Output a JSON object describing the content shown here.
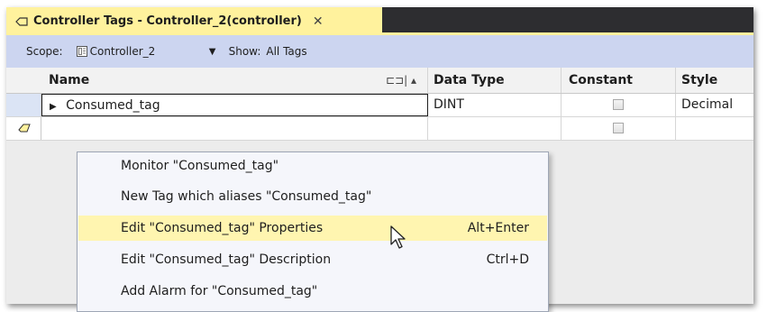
{
  "tab": {
    "title": "Controller Tags - Controller_2(controller)",
    "close_glyph": "✕",
    "icon": "tag-icon"
  },
  "scope_bar": {
    "scope_label": "Scope:",
    "scope_value": "Controller_2",
    "scope_icon": "controller-icon",
    "show_label": "Show:",
    "show_value": "All Tags"
  },
  "grid": {
    "columns": [
      "Name",
      "Data Type",
      "Constant",
      "Style"
    ],
    "filter_glyph": "⊏⊐| ▴",
    "rows": [
      {
        "name": "Consumed_tag",
        "data_type": "DINT",
        "constant": false,
        "style": "Decimal",
        "expandable": true
      },
      {
        "name": "",
        "data_type": "",
        "constant": false,
        "style": "",
        "new_row": true
      }
    ]
  },
  "context_menu": {
    "items": [
      {
        "label": "Monitor \"Consumed_tag\"",
        "shortcut": ""
      },
      {
        "label": "New Tag which aliases \"Consumed_tag\"",
        "shortcut": ""
      },
      {
        "label": "Edit \"Consumed_tag\" Properties",
        "shortcut": "Alt+Enter",
        "highlighted": true
      },
      {
        "label": "Edit \"Consumed_tag\" Description",
        "shortcut": "Ctrl+D"
      },
      {
        "label": "Add Alarm for \"Consumed_tag\"",
        "shortcut": ""
      }
    ]
  },
  "colors": {
    "tab_accent": "#fff29d",
    "scope_bar": "#ccd5f0",
    "tabstrip_bg": "#2d2d30",
    "menu_highlight": "#fff5b0"
  }
}
